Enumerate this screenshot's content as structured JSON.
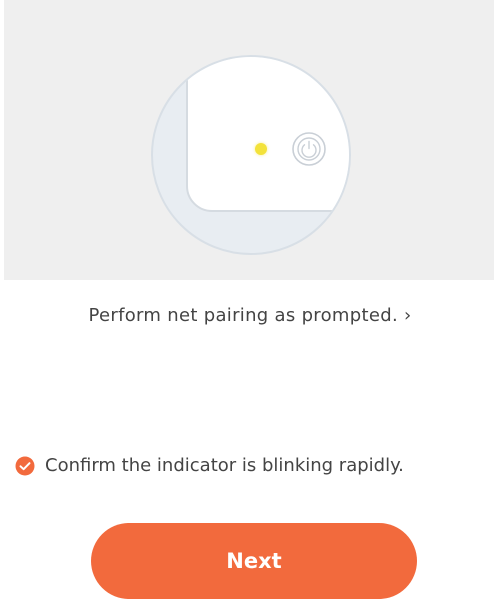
{
  "illustration": {
    "led_color": "#f3e23a",
    "icons": [
      "indicator-led",
      "power-icon"
    ]
  },
  "prompt": {
    "text": "Perform net pairing as prompted.",
    "chevron": "›"
  },
  "confirm": {
    "label": "Confirm the indicator is blinking rapidly.",
    "checked": true,
    "icon": "check-circle-icon"
  },
  "actions": {
    "next_label": "Next"
  },
  "colors": {
    "accent": "#f26a3d",
    "panel_bg": "#efefef",
    "text": "#444444"
  }
}
